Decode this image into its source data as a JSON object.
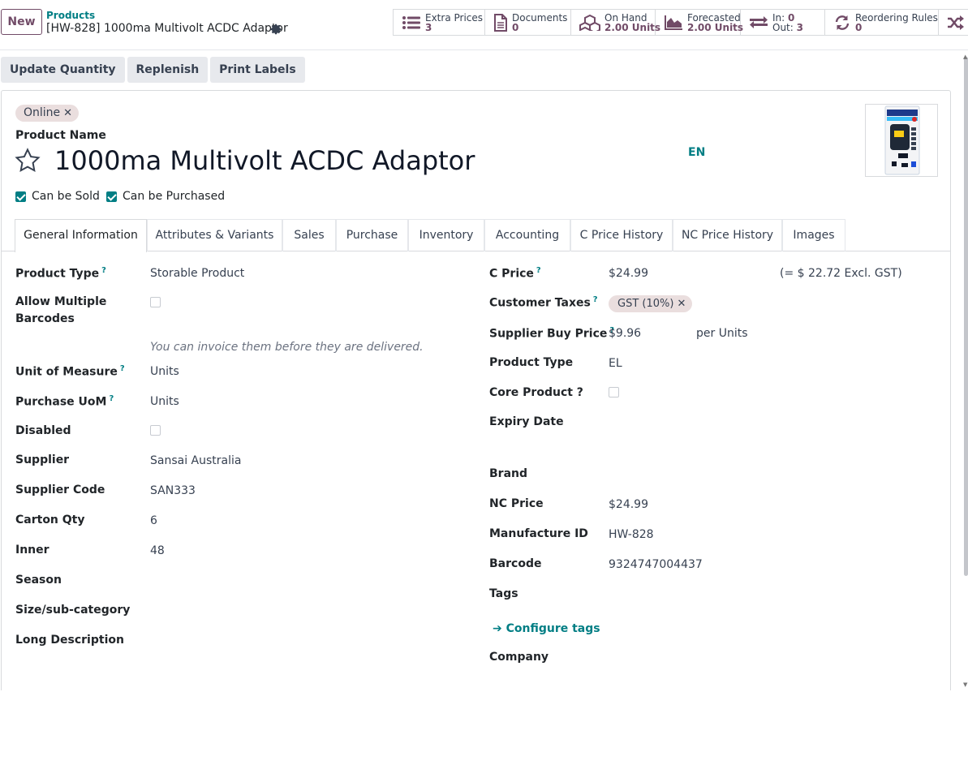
{
  "topbar": {
    "new_label": "New",
    "breadcrumb_parent": "Products",
    "breadcrumb_current": "[HW-828] 1000ma Multivolt ACDC Adaptor"
  },
  "stats": {
    "extra_prices": {
      "label": "Extra Prices",
      "value": "3"
    },
    "documents": {
      "label": "Documents",
      "value": "0"
    },
    "on_hand": {
      "label": "On Hand",
      "value": "2.00 Units"
    },
    "forecasted": {
      "label": "Forecasted",
      "value": "2.00 Units"
    },
    "in_out": {
      "in_label": "In:",
      "in_value": "0",
      "out_label": "Out:",
      "out_value": "3"
    },
    "reordering": {
      "label": "Reordering Rules",
      "value": "0"
    }
  },
  "actions": {
    "update_quantity": "Update Quantity",
    "replenish": "Replenish",
    "print_labels": "Print Labels"
  },
  "product": {
    "tag": "Online",
    "name_label": "Product Name",
    "name": "1000ma Multivolt ACDC Adaptor",
    "lang": "EN",
    "can_be_sold": "Can be Sold",
    "can_be_purchased": "Can be Purchased"
  },
  "tabs": [
    "General Information",
    "Attributes & Variants",
    "Sales",
    "Purchase",
    "Inventory",
    "Accounting",
    "C Price History",
    "NC Price History",
    "Images"
  ],
  "left": {
    "product_type_label": "Product Type",
    "product_type_value": "Storable Product",
    "allow_multiple_label_1": "Allow Multiple",
    "allow_multiple_label_2": "Barcodes",
    "invoice_hint": "You can invoice them before they are delivered.",
    "uom_label": "Unit of Measure",
    "uom_value": "Units",
    "purchase_uom_label": "Purchase UoM",
    "purchase_uom_value": "Units",
    "disabled_label": "Disabled",
    "supplier_label": "Supplier",
    "supplier_value": "Sansai Australia",
    "supplier_code_label": "Supplier Code",
    "supplier_code_value": "SAN333",
    "carton_qty_label": "Carton Qty",
    "carton_qty_value": "6",
    "inner_label": "Inner",
    "inner_value": "48",
    "season_label": "Season",
    "size_label": "Size/sub-category",
    "long_desc_label": "Long Description"
  },
  "right": {
    "c_price_label": "C Price",
    "c_price_value": "$24.99",
    "c_price_excl": "(= $ 22.72 Excl. GST)",
    "customer_taxes_label": "Customer Taxes",
    "customer_taxes_tag": "GST (10%)",
    "supplier_buy_label": "Supplier Buy Price",
    "supplier_buy_value": "$9.96",
    "supplier_buy_unit": "per Units",
    "product_type_label": "Product Type",
    "product_type_value": "EL",
    "core_product_label": "Core Product ?",
    "expiry_label": "Expiry Date",
    "brand_label": "Brand",
    "nc_price_label": "NC Price",
    "nc_price_value": "$24.99",
    "manufacture_id_label": "Manufacture ID",
    "manufacture_id_value": "HW-828",
    "barcode_label": "Barcode",
    "barcode_value": "9324747004437",
    "tags_label": "Tags",
    "configure_tags": "Configure tags",
    "company_label": "Company"
  },
  "colors": {
    "brand": "#714b67",
    "accent": "#017e84",
    "tag_bg": "#eadede"
  }
}
